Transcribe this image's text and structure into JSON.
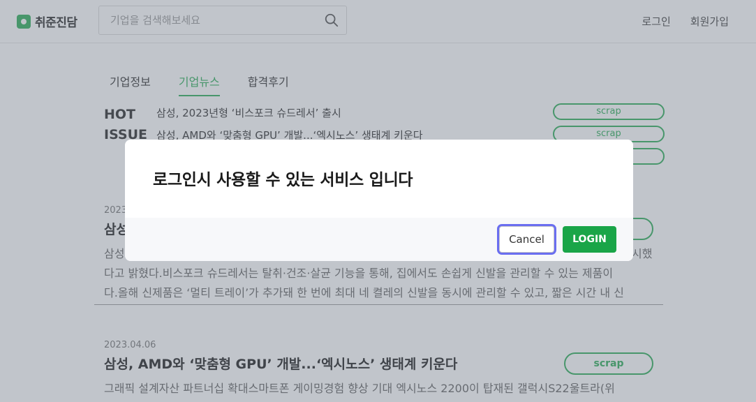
{
  "header": {
    "logo_text": "취준진담",
    "search_placeholder": "기업을 검색해보세요",
    "nav": {
      "login": "로그인",
      "signup": "회원가입"
    }
  },
  "tabs": [
    {
      "label": "기업정보",
      "active": false
    },
    {
      "label": "기업뉴스",
      "active": true
    },
    {
      "label": "합격후기",
      "active": false
    }
  ],
  "hot_issue": {
    "label_line1": "HOT",
    "label_line2": "ISSUE",
    "items": [
      {
        "title": "삼성, 2023년형 ‘비스포크 슈드레서’ 출시",
        "scrap": "scrap"
      },
      {
        "title": "삼성, AMD와 ‘맞춤형 GPU’ 개발...‘엑시노스’ 생태계 키운다",
        "scrap": "scrap"
      },
      {
        "title": "",
        "scrap": ""
      }
    ]
  },
  "articles": [
    {
      "date": "2023",
      "title": "삼성",
      "scrap": "",
      "body_prefix": "삼성",
      "body_suffix": "시했",
      "body_line2": "다고 밝혔다.비스포크 슈드레서는 탈취·건조·살균 기능을 통해, 집에서도 손쉽게 신발을 관리할 수 있는 제품이",
      "body_line3": "다.올해 신제품은 ‘멀티 트레이’가 추가돼 한 번에 최대 네 켤레의 신발을 동시에 관리할 수 있고, 짧은 시간 내 신"
    },
    {
      "date": "2023.04.06",
      "title": "삼성, AMD와 ‘맞춤형 GPU’ 개발...‘엑시노스’ 생태계 키운다",
      "scrap": "scrap",
      "body_line1": "그래픽 설계자산 파트너십 확대스마트폰 게이밍경험 향상 기대 엑시노스 2200이 탑재된 갤럭시S22울트라(위"
    }
  ],
  "modal": {
    "message": "로그인시 사용할 수 있는 서비스 입니다",
    "cancel_label": "Cancel",
    "login_label": "LOGIN"
  },
  "colors": {
    "brand_green": "#2fae5a",
    "login_button": "#1aa548",
    "focus_ring": "#6a6ef0"
  }
}
